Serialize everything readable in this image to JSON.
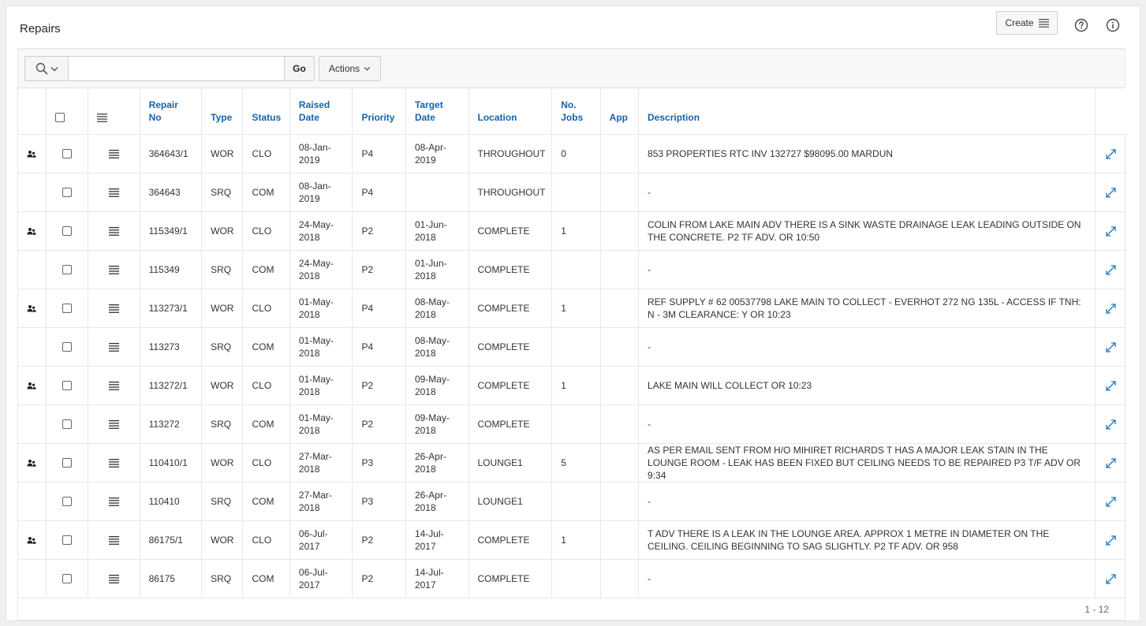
{
  "region": {
    "title": "Repairs",
    "create_label": "Create",
    "help_icon": "question-circle-icon",
    "info_icon": "info-circle-icon"
  },
  "toolbar": {
    "search_icon": "search-icon",
    "search_value": "",
    "go_label": "Go",
    "actions_label": "Actions"
  },
  "columns": {
    "repair_no": "Repair No",
    "type": "Type",
    "status": "Status",
    "raised_date": "Raised Date",
    "priority": "Priority",
    "target_date": "Target Date",
    "location": "Location",
    "no_jobs": "No. Jobs",
    "app": "App",
    "description": "Description"
  },
  "rows": [
    {
      "has_icon": true,
      "repair_no": "364643/1",
      "type": "WOR",
      "status": "CLO",
      "raised": "08-Jan-2019",
      "priority": "P4",
      "target": "08-Apr-2019",
      "location": "THROUGHOUT",
      "jobs": "0",
      "app": "",
      "description": "853 PROPERTIES RTC INV 132727 $98095.00 MARDUN"
    },
    {
      "has_icon": false,
      "repair_no": "364643",
      "type": "SRQ",
      "status": "COM",
      "raised": "08-Jan-2019",
      "priority": "P4",
      "target": "",
      "location": "THROUGHOUT",
      "jobs": "",
      "app": "",
      "description": "-"
    },
    {
      "has_icon": true,
      "repair_no": "115349/1",
      "type": "WOR",
      "status": "CLO",
      "raised": "24-May-2018",
      "priority": "P2",
      "target": "01-Jun-2018",
      "location": "COMPLETE",
      "jobs": "1",
      "app": "",
      "description": "COLIN FROM LAKE MAIN ADV THERE IS A SINK WASTE DRAINAGE LEAK LEADING OUTSIDE ON THE CONCRETE. P2 TF ADV. OR 10:50"
    },
    {
      "has_icon": false,
      "repair_no": "115349",
      "type": "SRQ",
      "status": "COM",
      "raised": "24-May-2018",
      "priority": "P2",
      "target": "01-Jun-2018",
      "location": "COMPLETE",
      "jobs": "",
      "app": "",
      "description": "-"
    },
    {
      "has_icon": true,
      "repair_no": "113273/1",
      "type": "WOR",
      "status": "CLO",
      "raised": "01-May-2018",
      "priority": "P4",
      "target": "08-May-2018",
      "location": "COMPLETE",
      "jobs": "1",
      "app": "",
      "description": "REF SUPPLY # 62 00537798 LAKE MAIN TO COLLECT - EVERHOT 272 NG 135L - ACCESS IF TNH: N - 3M CLEARANCE: Y OR 10:23"
    },
    {
      "has_icon": false,
      "repair_no": "113273",
      "type": "SRQ",
      "status": "COM",
      "raised": "01-May-2018",
      "priority": "P4",
      "target": "08-May-2018",
      "location": "COMPLETE",
      "jobs": "",
      "app": "",
      "description": "-"
    },
    {
      "has_icon": true,
      "repair_no": "113272/1",
      "type": "WOR",
      "status": "CLO",
      "raised": "01-May-2018",
      "priority": "P2",
      "target": "09-May-2018",
      "location": "COMPLETE",
      "jobs": "1",
      "app": "",
      "description": "LAKE MAIN WILL COLLECT OR 10:23"
    },
    {
      "has_icon": false,
      "repair_no": "113272",
      "type": "SRQ",
      "status": "COM",
      "raised": "01-May-2018",
      "priority": "P2",
      "target": "09-May-2018",
      "location": "COMPLETE",
      "jobs": "",
      "app": "",
      "description": "-"
    },
    {
      "has_icon": true,
      "repair_no": "110410/1",
      "type": "WOR",
      "status": "CLO",
      "raised": "27-Mar-2018",
      "priority": "P3",
      "target": "26-Apr-2018",
      "location": "LOUNGE1",
      "jobs": "5",
      "app": "",
      "description": "AS PER EMAIL SENT FROM H/O MIHIRET RICHARDS T HAS A MAJOR LEAK STAIN IN THE LOUNGE ROOM - LEAK HAS BEEN FIXED BUT CEILING NEEDS TO BE REPAIRED P3 T/F ADV OR 9:34"
    },
    {
      "has_icon": false,
      "repair_no": "110410",
      "type": "SRQ",
      "status": "COM",
      "raised": "27-Mar-2018",
      "priority": "P3",
      "target": "26-Apr-2018",
      "location": "LOUNGE1",
      "jobs": "",
      "app": "",
      "description": "-"
    },
    {
      "has_icon": true,
      "repair_no": "86175/1",
      "type": "WOR",
      "status": "CLO",
      "raised": "06-Jul-2017",
      "priority": "P2",
      "target": "14-Jul-2017",
      "location": "COMPLETE",
      "jobs": "1",
      "app": "",
      "description": "T ADV THERE IS A LEAK IN THE LOUNGE AREA. APPROX 1 METRE IN DIAMETER ON THE CEILING. CEILING BEGINNING TO SAG SLIGHTLY. P2 TF ADV. OR 958"
    },
    {
      "has_icon": false,
      "repair_no": "86175",
      "type": "SRQ",
      "status": "COM",
      "raised": "06-Jul-2017",
      "priority": "P2",
      "target": "14-Jul-2017",
      "location": "COMPLETE",
      "jobs": "",
      "app": "",
      "description": "-"
    }
  ],
  "row_icons": {
    "work_order": "users-icon",
    "row_menu": "hamburger-menu-icon",
    "open": "expand-arrow-icon"
  },
  "pagination": "1 - 12",
  "colors": {
    "header_link": "#1565a8",
    "expand_icon": "#1a78c8"
  }
}
